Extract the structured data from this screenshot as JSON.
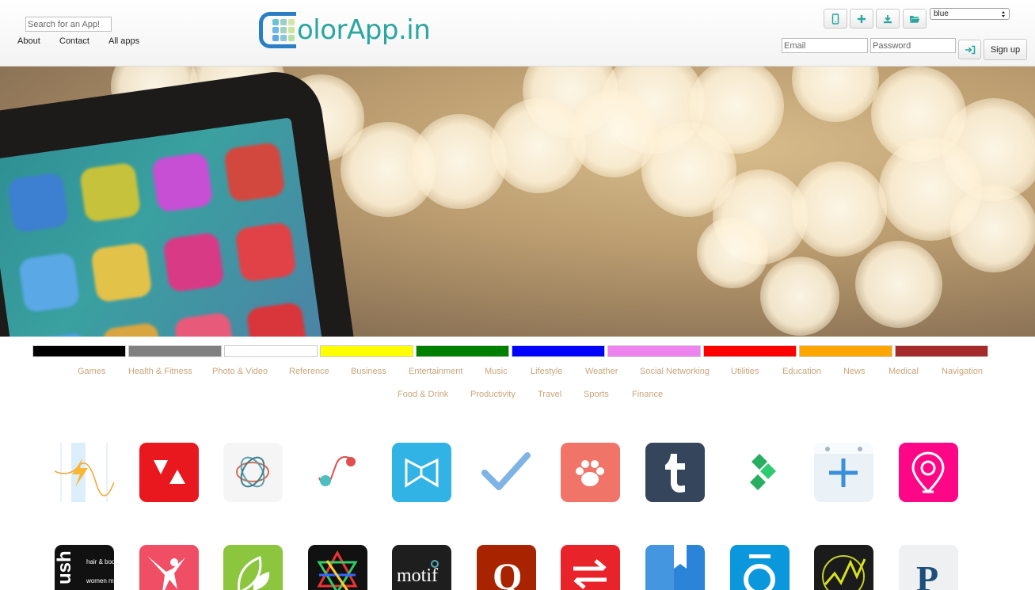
{
  "header": {
    "search_placeholder": "Search for an App!",
    "nav": [
      "About",
      "Contact",
      "All apps"
    ],
    "logo_text": "olorApp.in",
    "toolbar_icons": [
      "mobile-icon",
      "plus-icon",
      "download-icon",
      "folder-open-icon"
    ],
    "color_select": "blue",
    "email_placeholder": "Email",
    "password_placeholder": "Password",
    "signup_label": "Sign up"
  },
  "colors": [
    "#000000",
    "#808080",
    "#ffffff",
    "#ffff00",
    "#008000",
    "#0000ff",
    "#ee82ee",
    "#ff0000",
    "#ffa500",
    "#a52a2a"
  ],
  "categories_row1": [
    "Games",
    "Health & Fitness",
    "Photo & Video",
    "Reference",
    "Business",
    "Entertainment",
    "Music",
    "Lifestyle",
    "Weather",
    "Social Networking",
    "Utilities",
    "Education",
    "News",
    "Medical",
    "Navigation"
  ],
  "categories_row2": [
    "Food & Drink",
    "Productivity",
    "Travel",
    "Sports",
    "Finance"
  ],
  "apps_row2_text": {
    "ush": "ush",
    "hair": "hair & body",
    "women": "women men",
    "motif": "motif",
    "q": "Q",
    "p": "P"
  }
}
